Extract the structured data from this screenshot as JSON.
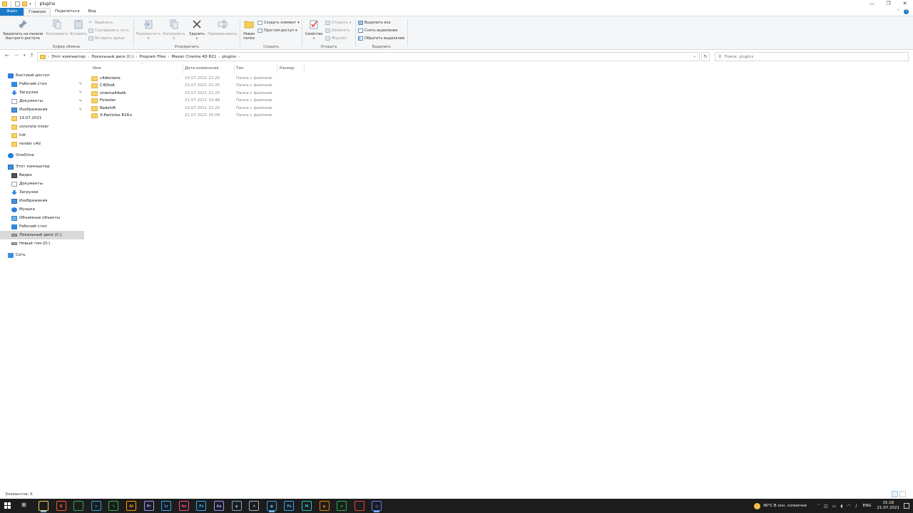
{
  "window": {
    "title": "plugins"
  },
  "tabs": [
    {
      "label": "Файл"
    },
    {
      "label": "Главная"
    },
    {
      "label": "Поделиться"
    },
    {
      "label": "Вид"
    }
  ],
  "ribbon": {
    "clipboard": {
      "label": "Буфер обмена",
      "pin_line1": "Закрепить на панели",
      "pin_line2": "быстрого доступа",
      "copy": "Копировать",
      "paste": "Вставить",
      "cut": "Вырезать",
      "copy_path": "Скопировать путь",
      "paste_shortcut": "Вставить ярлык"
    },
    "organize": {
      "label": "Упорядочить",
      "move_line1": "Переместить",
      "move_line2": "в",
      "copyto_line1": "Копировать",
      "copyto_line2": "в",
      "delete": "Удалить",
      "rename": "Переименовать"
    },
    "create": {
      "label": "Создать",
      "new_folder_line1": "Новая",
      "new_folder_line2": "папка",
      "new_item": "Создать элемент",
      "easy_access": "Простой доступ"
    },
    "open": {
      "label": "Открыть",
      "properties": "Свойства",
      "open": "Открыть",
      "edit": "Изменить",
      "history": "Журнал"
    },
    "select": {
      "label": "Выделить",
      "select_all": "Выделить все",
      "select_none": "Снять выделение",
      "invert": "Обратить выделение"
    }
  },
  "address": {
    "crumbs": [
      "Этот компьютер",
      "Локальный диск (C:)",
      "Program Files",
      "Maxon Cinema 4D R21",
      "plugins"
    ],
    "search_placeholder": "Поиск: plugins"
  },
  "nav": [
    {
      "label": "Быстрый доступ",
      "icon": "star-icon",
      "indent": 0,
      "pinned": false
    },
    {
      "label": "Рабочий стол",
      "icon": "desktop-icon",
      "indent": 1,
      "pinned": true
    },
    {
      "label": "Загрузки",
      "icon": "download-icon",
      "indent": 1,
      "pinned": true
    },
    {
      "label": "Документы",
      "icon": "document-icon",
      "indent": 1,
      "pinned": true
    },
    {
      "label": "Изображения",
      "icon": "picture-icon",
      "indent": 1,
      "pinned": true
    },
    {
      "label": "19.07.2021",
      "icon": "folder-icon",
      "indent": 1,
      "pinned": false
    },
    {
      "label": "concrete mixer",
      "icon": "folder-icon",
      "indent": 1,
      "pinned": false
    },
    {
      "label": "hdr",
      "icon": "folder-icon",
      "indent": 1,
      "pinned": false
    },
    {
      "label": "render c4d",
      "icon": "folder-icon",
      "indent": 1,
      "pinned": false
    },
    {
      "label": "OneDrive",
      "icon": "cloud-icon",
      "indent": 0,
      "pinned": false
    },
    {
      "label": "Этот компьютер",
      "icon": "computer-icon",
      "indent": 0,
      "pinned": false
    },
    {
      "label": "Видео",
      "icon": "video-icon",
      "indent": 1,
      "pinned": false
    },
    {
      "label": "Документы",
      "icon": "document-icon",
      "indent": 1,
      "pinned": false
    },
    {
      "label": "Загрузки",
      "icon": "download-icon",
      "indent": 1,
      "pinned": false
    },
    {
      "label": "Изображения",
      "icon": "picture-icon",
      "indent": 1,
      "pinned": false
    },
    {
      "label": "Музыка",
      "icon": "music-icon",
      "indent": 1,
      "pinned": false
    },
    {
      "label": "Объемные объекты",
      "icon": "cube-icon",
      "indent": 1,
      "pinned": false
    },
    {
      "label": "Рабочий стол",
      "icon": "desktop-icon",
      "indent": 1,
      "pinned": false
    },
    {
      "label": "Локальный диск (C:)",
      "icon": "drive-icon",
      "indent": 1,
      "pinned": false,
      "selected": true
    },
    {
      "label": "Новый том (D:)",
      "icon": "drive-icon",
      "indent": 1,
      "pinned": false
    },
    {
      "label": "Сеть",
      "icon": "network-icon",
      "indent": 0,
      "pinned": false
    }
  ],
  "columns": {
    "name": "Имя",
    "date": "Дата изменения",
    "type": "Тип",
    "size": "Размер"
  },
  "files": [
    {
      "name": "c4doctane",
      "date": "15.07.2021 21:25",
      "type": "Папка с файлами"
    },
    {
      "name": "C4DtoA",
      "date": "15.07.2021 21:25",
      "type": "Папка с файлами"
    },
    {
      "name": "cinema4dsdk",
      "date": "15.07.2021 21:25",
      "type": "Папка с файлами"
    },
    {
      "name": "Forester",
      "date": "21.07.2021 14:48",
      "type": "Папка с файлами"
    },
    {
      "name": "Redshift",
      "date": "15.07.2021 21:25",
      "type": "Папка с файлами"
    },
    {
      "name": "X-Particles R16+",
      "date": "21.07.2021 15:09",
      "type": "Папка с файлами"
    }
  ],
  "status": {
    "items": "Элементов: 6"
  },
  "taskbar": {
    "apps": [
      {
        "name": "file-explorer",
        "glyph": "",
        "color": "#f5cf5a",
        "active": true
      },
      {
        "name": "brave",
        "glyph": "B",
        "color": "#fb542b"
      },
      {
        "name": "chrome",
        "glyph": "",
        "color": "#34a853"
      },
      {
        "name": "telegram",
        "glyph": "➤",
        "color": "#2aa3e0"
      },
      {
        "name": "app-green",
        "glyph": "✎",
        "color": "#2fb34a"
      },
      {
        "name": "illustrator",
        "glyph": "Ai",
        "color": "#ff9a00"
      },
      {
        "name": "premiere",
        "glyph": "Pr",
        "color": "#9999ff"
      },
      {
        "name": "lightroom",
        "glyph": "Lr",
        "color": "#31a8ff"
      },
      {
        "name": "animate",
        "glyph": "An",
        "color": "#ff4a7f"
      },
      {
        "name": "photoshop",
        "glyph": "Ps",
        "color": "#31a8ff"
      },
      {
        "name": "after-effects",
        "glyph": "Ae",
        "color": "#9999ff"
      },
      {
        "name": "app-cube",
        "glyph": "◆",
        "color": "#7aa7c7"
      },
      {
        "name": "app-gear",
        "glyph": "✲",
        "color": "#a0b4c8"
      },
      {
        "name": "app-blue",
        "glyph": "●",
        "color": "#3a9bdc",
        "active": true
      },
      {
        "name": "photoshop-2",
        "glyph": "Ps",
        "color": "#31a8ff"
      },
      {
        "name": "app-m",
        "glyph": "M",
        "color": "#1ec8c8"
      },
      {
        "name": "blender",
        "glyph": "◉",
        "color": "#e87d0d"
      },
      {
        "name": "spotify",
        "glyph": "≋",
        "color": "#1db954"
      },
      {
        "name": "chrome-2",
        "glyph": "",
        "color": "#ea4335"
      },
      {
        "name": "cinema4d",
        "glyph": "◎",
        "color": "#5580ff",
        "active": true
      }
    ],
    "weather": "36°C  В осн. солнечно",
    "lang": "ENG",
    "time": "15:18",
    "date": "21.07.2021"
  }
}
